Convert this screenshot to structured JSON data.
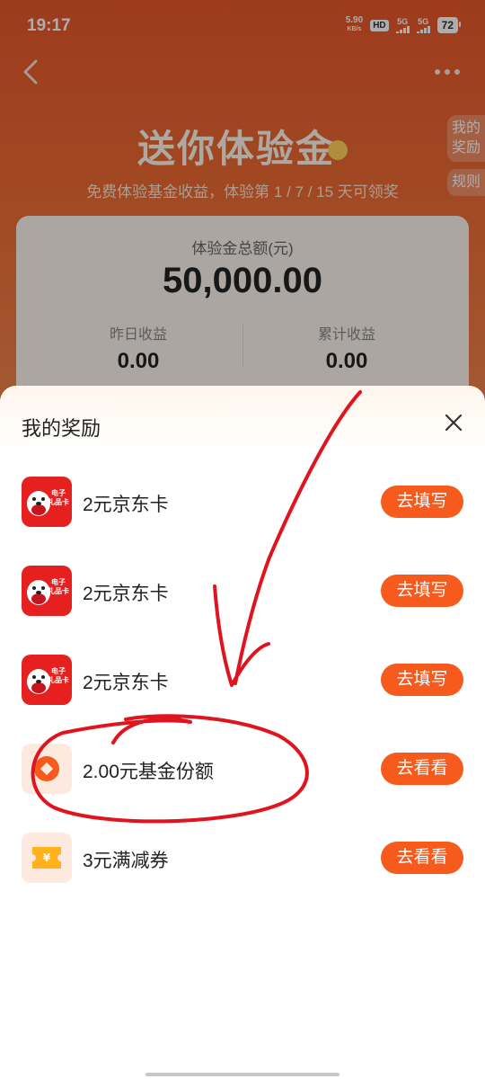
{
  "status_bar": {
    "time": "19:17",
    "net_speed_value": "5.90",
    "net_speed_unit": "KB/s",
    "hd_label": "HD",
    "signal1_label": "5G",
    "signal2_label": "5G",
    "battery": "72"
  },
  "page": {
    "hero_title": "送你体验金",
    "subtitle": "免费体验基金收益，体验第 1 / 7 / 15 天可领奖",
    "side_rewards_label": "我的奖励",
    "side_rules_label": "规则"
  },
  "summary": {
    "total_label": "体验金总额(元)",
    "total_amount": "50,000.00",
    "yesterday_label": "昨日收益",
    "yesterday_value": "0.00",
    "cumulative_label": "累计收益",
    "cumulative_value": "0.00"
  },
  "sheet": {
    "title": "我的奖励",
    "items": [
      {
        "name": "2元京东卡",
        "button": "去填写",
        "icon": "jd-gift-card-icon",
        "card_label_1": "电子",
        "card_label_2": "礼品卡"
      },
      {
        "name": "2元京东卡",
        "button": "去填写",
        "icon": "jd-gift-card-icon",
        "card_label_1": "电子",
        "card_label_2": "礼品卡"
      },
      {
        "name": "2元京东卡",
        "button": "去填写",
        "icon": "jd-gift-card-icon",
        "card_label_1": "电子",
        "card_label_2": "礼品卡"
      },
      {
        "name": "2.00元基金份额",
        "button": "去看看",
        "icon": "fund-coin-icon"
      },
      {
        "name": "3元满减券",
        "button": "去看看",
        "icon": "yuan-coupon-icon"
      }
    ]
  },
  "colors": {
    "accent": "#f65a1d",
    "annotation": "#e0141e"
  }
}
